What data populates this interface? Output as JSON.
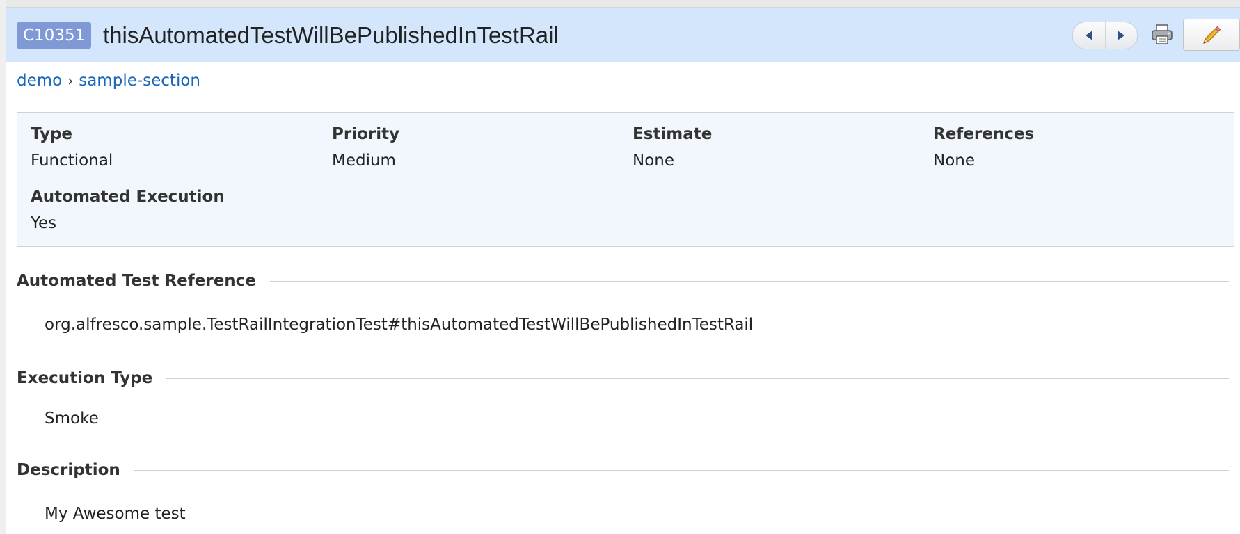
{
  "header": {
    "case_id": "C10351",
    "title": "thisAutomatedTestWillBePublishedInTestRail"
  },
  "breadcrumb": {
    "items": [
      "demo",
      "sample-section"
    ],
    "separator": "›"
  },
  "properties": [
    {
      "label": "Type",
      "value": "Functional"
    },
    {
      "label": "Priority",
      "value": "Medium"
    },
    {
      "label": "Estimate",
      "value": "None"
    },
    {
      "label": "References",
      "value": "None"
    },
    {
      "label": "Automated Execution",
      "value": "Yes"
    }
  ],
  "sections": [
    {
      "title": "Automated Test Reference",
      "body": "org.alfresco.sample.TestRailIntegrationTest#thisAutomatedTestWillBePublishedInTestRail"
    },
    {
      "title": "Execution Type",
      "body": "Smoke"
    },
    {
      "title": "Description",
      "body": "My Awesome test"
    }
  ],
  "icons": {
    "prev": "caret-left-icon",
    "next": "caret-right-icon",
    "print": "printer-icon",
    "edit": "pencil-icon"
  },
  "colors": {
    "header_bg": "#d3e6fb",
    "id_badge": "#7f98d6",
    "link": "#1a66b8",
    "props_bg": "#f1f7fc"
  }
}
